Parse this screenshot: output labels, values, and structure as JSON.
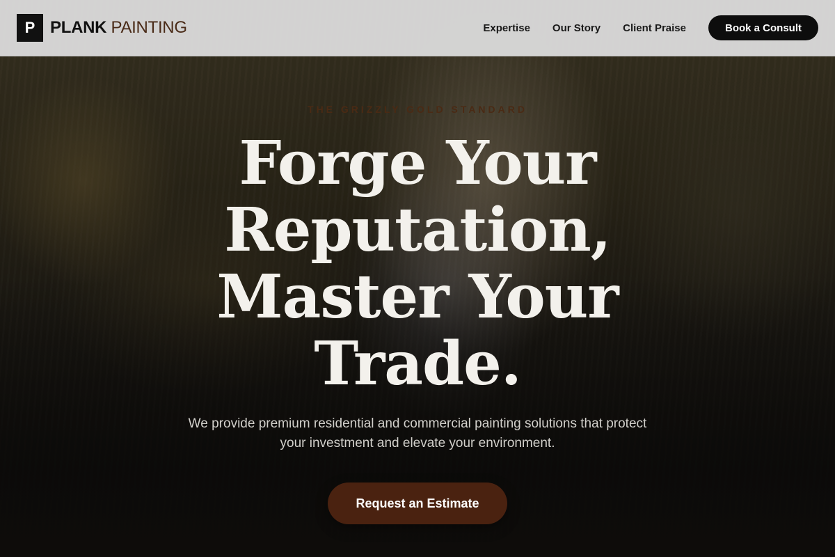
{
  "brand": {
    "mark": "P",
    "name_strong": "PLANK",
    "name_light": "PAINTING"
  },
  "nav": {
    "items": [
      {
        "label": "Expertise"
      },
      {
        "label": "Our Story"
      },
      {
        "label": "Client Praise"
      }
    ],
    "cta_label": "Book a Consult"
  },
  "hero": {
    "eyebrow": "The Grizzly Gold Standard",
    "headline": "Forge Your Reputation, Master Your Trade.",
    "subhead": "We provide premium residential and commercial painting solutions that protect your investment and elevate your environment.",
    "button_label": "Request an Estimate"
  },
  "colors": {
    "accent": "#4a2210",
    "header_bg": "#dadada",
    "cta_bg": "#0d0d0d",
    "headline": "#f3f1ec"
  }
}
